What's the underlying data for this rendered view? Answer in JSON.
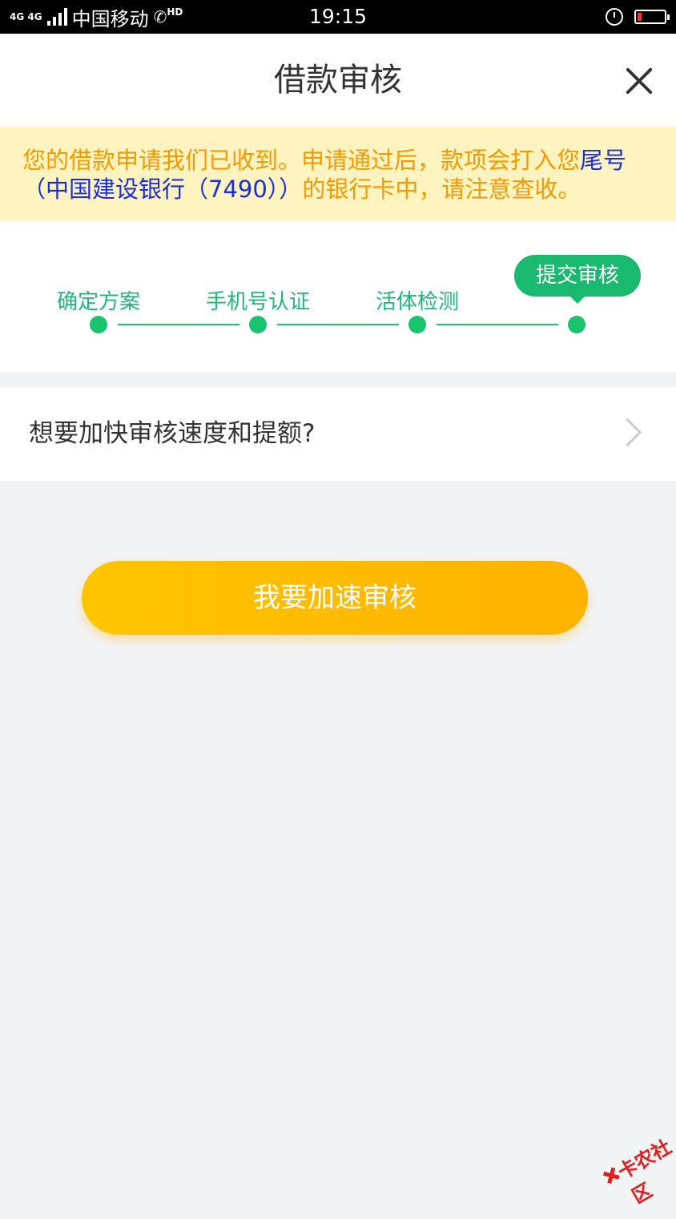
{
  "status_bar": {
    "network": "4G 4G",
    "carrier": "中国移动",
    "hd": "HD",
    "time": "19:15",
    "battery_level": 0.15
  },
  "header": {
    "title": "借款审核"
  },
  "notice": {
    "text_orange": "您的借款申请我们已收到。申请通过后，款项会打入您",
    "text_blue": "尾号（中国建设银行（7490））",
    "text_orange_tail": "的银行卡中，请注意查收。"
  },
  "steps": {
    "items": [
      {
        "label": "确定方案"
      },
      {
        "label": "手机号认证"
      },
      {
        "label": "活体检测"
      },
      {
        "label": "提交审核",
        "current": true
      }
    ]
  },
  "speed_row": {
    "text": "想要加快审核速度和提额?"
  },
  "main_button": {
    "label": "我要加速审核"
  },
  "watermark": {
    "text": "卡农社区"
  },
  "colors": {
    "accent_green": "#19c46e",
    "notice_bg": "#fff3bf",
    "notice_text": "#f59a00",
    "button_yellow": "#ffc400"
  }
}
